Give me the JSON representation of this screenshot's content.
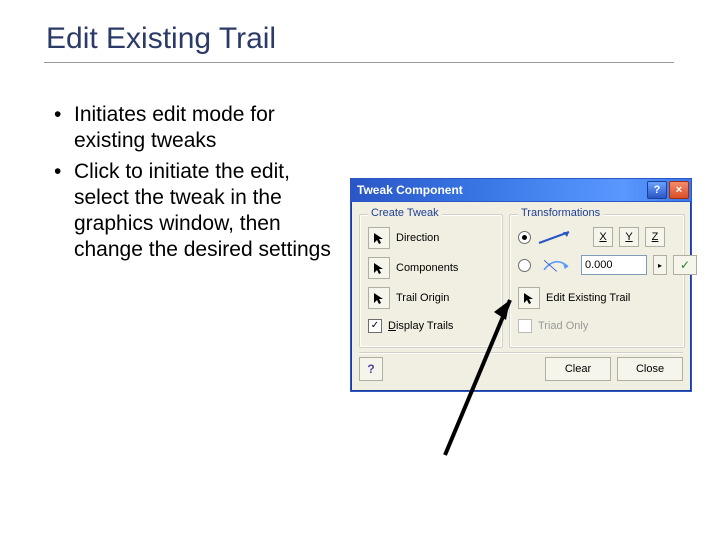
{
  "slide": {
    "title": "Edit Existing Trail",
    "bullets": [
      "Initiates edit mode for existing tweaks",
      "Click to initiate the edit, select the tweak in the graphics window, then change the desired settings"
    ]
  },
  "dialog": {
    "title": "Tweak Component",
    "create_group": {
      "legend": "Create Tweak",
      "direction": "Direction",
      "components": "Components",
      "trail_origin": "Trail Origin",
      "display_trails": "Display Trails",
      "display_trails_checked": "✓"
    },
    "trans_group": {
      "legend": "Transformations",
      "axes": {
        "x": "X",
        "y": "Y",
        "z": "Z"
      },
      "value": "0.000",
      "edit_existing": "Edit Existing Trail",
      "triad_only": "Triad Only"
    },
    "buttons": {
      "clear": "Clear",
      "close": "Close",
      "help_glyph": "?",
      "close_glyph": "×",
      "spin_glyph": "▸",
      "ok_glyph": "✓"
    }
  }
}
